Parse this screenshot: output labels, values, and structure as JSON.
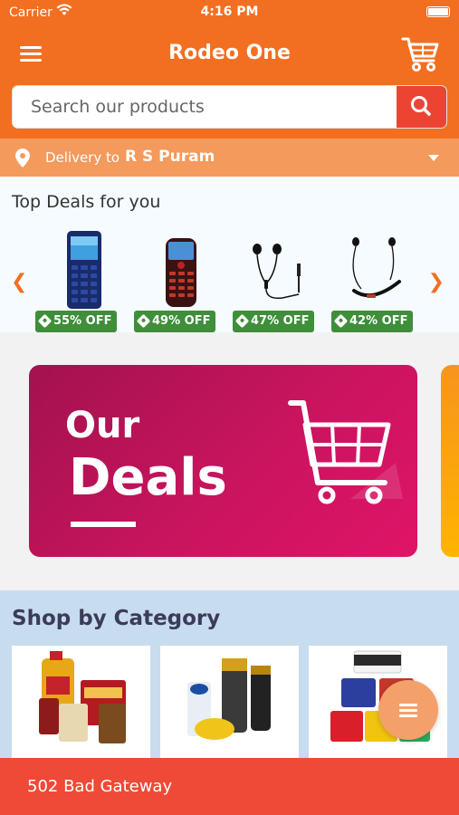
{
  "status_bar": {
    "carrier": "Carrier",
    "time": "4:16 PM"
  },
  "header": {
    "title": "Rodeo One",
    "menu_icon": "hamburger-icon",
    "cart_icon": "cart-icon"
  },
  "search": {
    "placeholder": "Search our products",
    "value": "",
    "icon": "search-icon"
  },
  "delivery": {
    "label": "Delivery to",
    "location": "R S Puram"
  },
  "top_deals": {
    "title": "Top Deals for you",
    "items": [
      {
        "discount": "55% OFF",
        "product": "feature-phone-blue"
      },
      {
        "discount": "49% OFF",
        "product": "feature-phone-red"
      },
      {
        "discount": "47% OFF",
        "product": "wired-earphones"
      },
      {
        "discount": "42% OFF",
        "product": "neckband-earphones"
      }
    ]
  },
  "banner": {
    "line1": "Our",
    "line2": "Deals"
  },
  "categories": {
    "title": "Shop by Category",
    "items": [
      "grocery",
      "personal-care",
      "paints"
    ]
  },
  "error": {
    "message": "502 Bad Gateway"
  },
  "colors": {
    "primary": "#f26f21",
    "search_button": "#ec4433",
    "badge": "#3e8e3a",
    "error": "#ef4937"
  }
}
